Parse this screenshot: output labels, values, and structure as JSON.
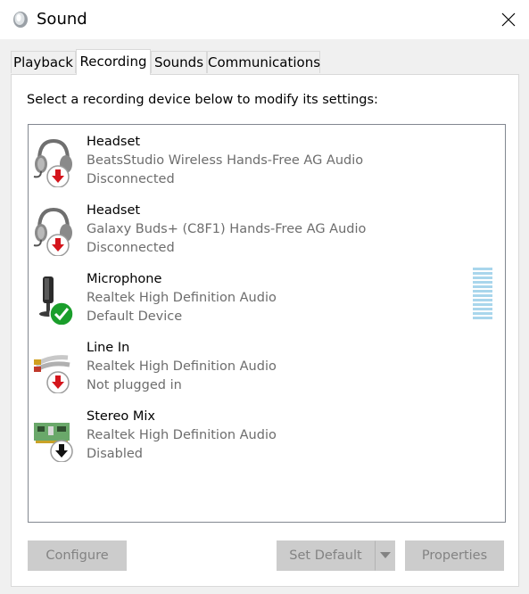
{
  "window": {
    "title": "Sound"
  },
  "tabs": [
    {
      "label": "Playback",
      "active": false
    },
    {
      "label": "Recording",
      "active": true
    },
    {
      "label": "Sounds",
      "active": false
    },
    {
      "label": "Communications",
      "active": false
    }
  ],
  "instruction": "Select a recording device below to modify its settings:",
  "devices": [
    {
      "name": "Headset",
      "description": "BeatsStudio Wireless Hands-Free AG Audio",
      "status": "Disconnected",
      "icon": "headset-icon",
      "badge": "red-down-arrow"
    },
    {
      "name": "Headset",
      "description": "Galaxy Buds+ (C8F1) Hands-Free AG Audio",
      "status": "Disconnected",
      "icon": "headset-icon",
      "badge": "red-down-arrow"
    },
    {
      "name": "Microphone",
      "description": "Realtek High Definition Audio",
      "status": "Default Device",
      "icon": "microphone-icon",
      "badge": "green-check"
    },
    {
      "name": "Line In",
      "description": "Realtek High Definition Audio",
      "status": "Not plugged in",
      "icon": "line-in-cable-icon",
      "badge": "red-down-arrow"
    },
    {
      "name": "Stereo Mix",
      "description": "Realtek High Definition Audio",
      "status": "Disabled",
      "icon": "sound-card-icon",
      "badge": "black-down-arrow"
    }
  ],
  "buttons": {
    "configure": "Configure",
    "set_default": "Set Default",
    "properties": "Properties"
  },
  "colors": {
    "red_badge": "#d4151c",
    "green_badge": "#1a9e2b",
    "disabled_bg": "#cccccc",
    "disabled_text": "#838383",
    "level_meter": "#a9d6ec"
  }
}
